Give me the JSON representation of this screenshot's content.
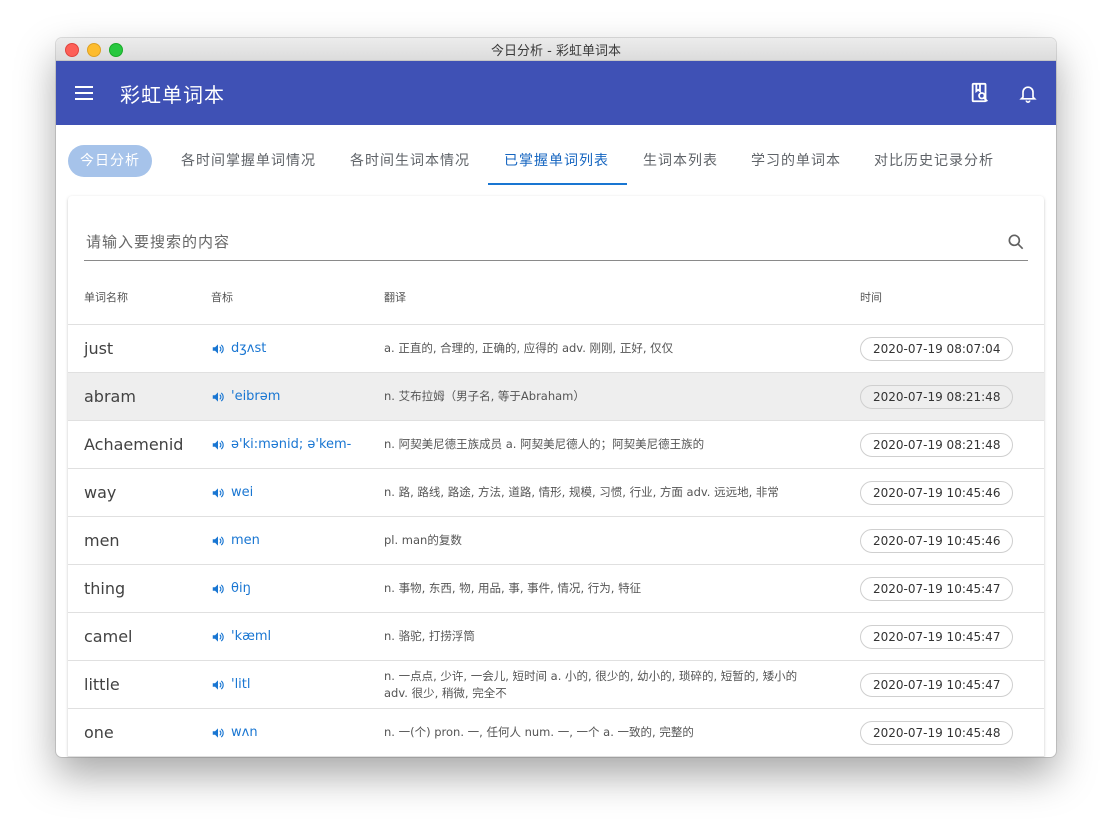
{
  "window": {
    "title": "今日分析 - 彩虹单词本"
  },
  "appbar": {
    "title": "彩虹单词本"
  },
  "tabs": [
    {
      "label": "今日分析"
    },
    {
      "label": "各时间掌握单词情况"
    },
    {
      "label": "各时间生词本情况"
    },
    {
      "label": "已掌握单词列表"
    },
    {
      "label": "生词本列表"
    },
    {
      "label": "学习的单词本"
    },
    {
      "label": "对比历史记录分析"
    }
  ],
  "search": {
    "placeholder": "请输入要搜索的内容"
  },
  "table": {
    "headers": {
      "word": "单词名称",
      "phonetic": "音标",
      "translation": "翻译",
      "time": "时间"
    },
    "rows": [
      {
        "word": "just",
        "phonetic": "dʒʌst",
        "translation": "a. 正直的, 合理的, 正确的, 应得的 adv. 刚刚, 正好, 仅仅",
        "time": "2020-07-19 08:07:04"
      },
      {
        "word": "abram",
        "phonetic": "'eibrəm",
        "translation": "n. 艾布拉姆（男子名, 等于Abraham）",
        "time": "2020-07-19 08:21:48"
      },
      {
        "word": "Achaemenid",
        "phonetic": "ə'ki:mənid; ə'kem-",
        "translation": "n. 阿契美尼德王族成员 a. 阿契美尼德人的；阿契美尼德王族的",
        "time": "2020-07-19 08:21:48"
      },
      {
        "word": "way",
        "phonetic": "wei",
        "translation": "n. 路, 路线, 路途, 方法, 道路, 情形, 规模, 习惯, 行业, 方面 adv. 远远地, 非常",
        "time": "2020-07-19 10:45:46"
      },
      {
        "word": "men",
        "phonetic": "men",
        "translation": "pl. man的复数",
        "time": "2020-07-19 10:45:46"
      },
      {
        "word": "thing",
        "phonetic": "θiŋ",
        "translation": "n. 事物, 东西, 物, 用品, 事, 事件, 情况, 行为, 特征",
        "time": "2020-07-19 10:45:47"
      },
      {
        "word": "camel",
        "phonetic": "'kæml",
        "translation": "n. 骆驼, 打捞浮筒",
        "time": "2020-07-19 10:45:47"
      },
      {
        "word": "little",
        "phonetic": "'litl",
        "translation": "n. 一点点, 少许, 一会儿, 短时间 a. 小的, 很少的, 幼小的, 琐碎的, 短暂的, 矮小的 adv. 很少, 稍微, 完全不",
        "time": "2020-07-19 10:45:47"
      },
      {
        "word": "one",
        "phonetic": "wʌn",
        "translation": "n. 一(个) pron. 一, 任何人 num. 一, 一个 a. 一致的, 完整的",
        "time": "2020-07-19 10:45:48"
      }
    ]
  },
  "colors": {
    "appbar": "#3f51b5",
    "accent": "#1976d2",
    "chip": "#a6c3ea"
  },
  "icons": {
    "menu": "menu-icon",
    "search_book": "book-search-icon",
    "notify": "bell-icon",
    "search": "search-icon",
    "speaker": "volume-icon"
  }
}
